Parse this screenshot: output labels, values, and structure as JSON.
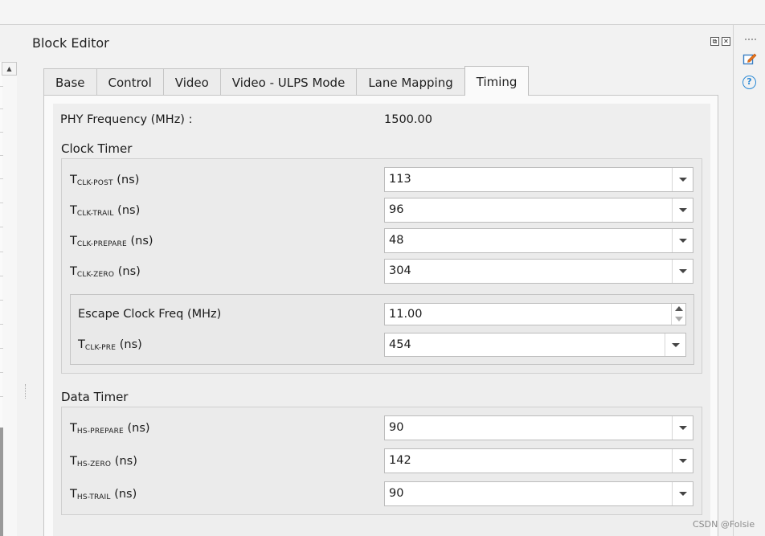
{
  "panel": {
    "title": "Block Editor"
  },
  "window_buttons": {
    "float": "⧉",
    "close": "✕"
  },
  "tabs": [
    {
      "label": "Base"
    },
    {
      "label": "Control"
    },
    {
      "label": "Video"
    },
    {
      "label": "Video - ULPS Mode"
    },
    {
      "label": "Lane Mapping"
    },
    {
      "label": "Timing",
      "active": true
    }
  ],
  "phy": {
    "label": "PHY Frequency (MHz) :",
    "value": "1500.00"
  },
  "clock_timer": {
    "title": "Clock Timer",
    "rows": [
      {
        "label_main": "T",
        "label_sub": "CLK-POST",
        "label_unit": "(ns)",
        "value": "113"
      },
      {
        "label_main": "T",
        "label_sub": "CLK-TRAIL",
        "label_unit": "(ns)",
        "value": "96"
      },
      {
        "label_main": "T",
        "label_sub": "CLK-PREPARE",
        "label_unit": "(ns)",
        "value": "48"
      },
      {
        "label_main": "T",
        "label_sub": "CLK-ZERO",
        "label_unit": "(ns)",
        "value": "304"
      }
    ],
    "escape": {
      "label": "Escape Clock Freq (MHz)",
      "value": "11.00",
      "pre": {
        "label_main": "T",
        "label_sub": "CLK-PRE",
        "label_unit": "(ns)",
        "value": "454"
      }
    }
  },
  "data_timer": {
    "title": "Data Timer",
    "rows": [
      {
        "label_main": "T",
        "label_sub": "HS-PREPARE",
        "label_unit": "(ns)",
        "value": "90"
      },
      {
        "label_main": "T",
        "label_sub": "HS-ZERO",
        "label_unit": "(ns)",
        "value": "142"
      },
      {
        "label_main": "T",
        "label_sub": "HS-TRAIL",
        "label_unit": "(ns)",
        "value": "90"
      }
    ]
  },
  "icons": {
    "edit": "edit-icon",
    "help": "help-icon",
    "scroll_up": "scroll-up-icon"
  },
  "help_glyph": "?",
  "scroll_glyph": "▲",
  "watermark": "CSDN @Folsie",
  "colors": {
    "help_blue": "#2b8ad6",
    "edit_orange": "#e8731a",
    "edit_blue": "#3a7fc4"
  }
}
